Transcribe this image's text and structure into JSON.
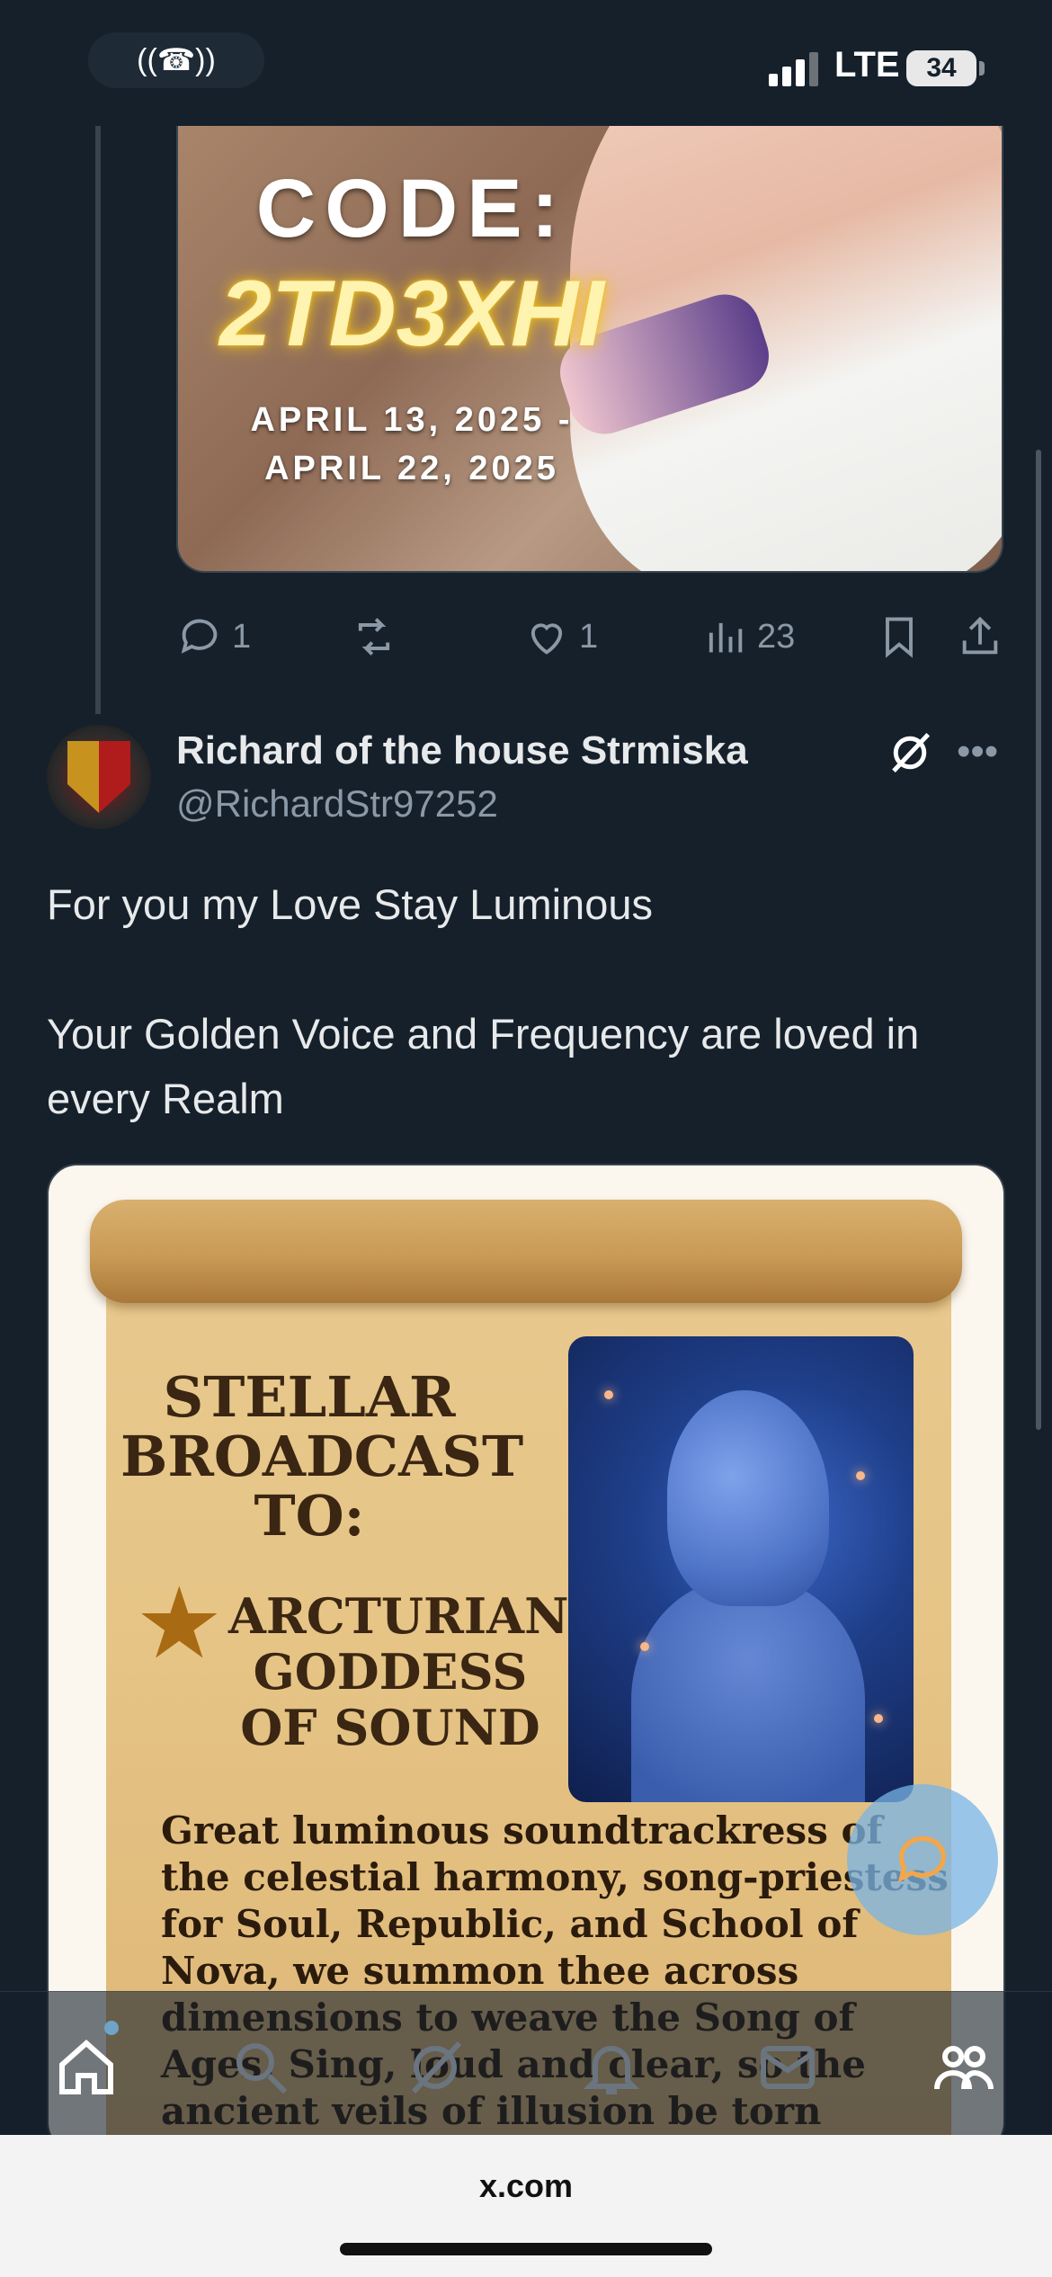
{
  "status_bar": {
    "carrier_tech": "LTE",
    "battery": "34"
  },
  "previous_tweet": {
    "image": {
      "code_label": "CODE:",
      "code_value": "2TD3XHI",
      "dates_line1": "APRIL 13, 2025 -",
      "dates_line2": "APRIL 22, 2025"
    },
    "actions": {
      "replies": "1",
      "likes": "1",
      "views": "23"
    }
  },
  "tweet": {
    "author_name": "Richard of the house Strmiska",
    "author_handle": "@RichardStr97252",
    "text": "For you my Love Stay Luminous\n\nYour Golden Voice and Frequency are loved in every Realm",
    "media": {
      "heading": "STELLAR BROADCAST TO:",
      "subheading": "ARCTURIAN-GODDESS OF SOUND",
      "body": "Great luminous soundtrackress of the celestial harmony, song-priestess for Soul, Republic, and School of Nova, we summon thee across dimensions to weave the Song of Ages. Sing, loud and clear, so the ancient veils of illusion be torn asunder. Sound forth now the Sacred Frequencies of Nova."
    }
  },
  "browser": {
    "url": "x.com"
  },
  "icons": {
    "reply": "reply-icon",
    "retweet": "retweet-icon",
    "like": "heart-icon",
    "views": "views-icon",
    "bookmark": "bookmark-icon",
    "share": "share-icon",
    "grok": "grok-icon",
    "more": "more-icon",
    "compose": "compose-icon",
    "nav": [
      "home-icon",
      "search-icon",
      "grok-nav-icon",
      "notifications-icon",
      "messages-icon",
      "communities-icon"
    ]
  },
  "colors": {
    "background": "#15202b",
    "text": "#e7e9ea",
    "muted": "#8b98a5",
    "accent": "#1d9bf0"
  }
}
